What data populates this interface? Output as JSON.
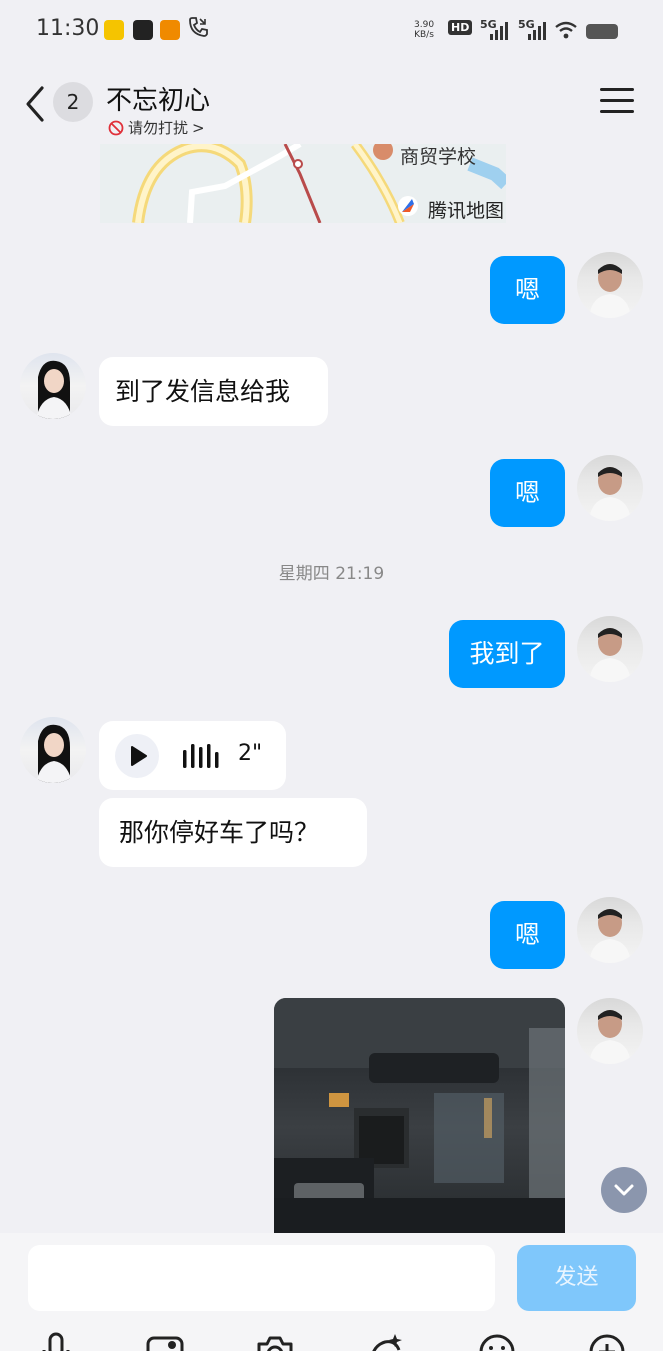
{
  "status_bar": {
    "time": "11:30",
    "net_speed_value": "3.90",
    "net_speed_unit": "KB/s",
    "hd_label": "HD",
    "signal_1": "5G",
    "signal_2": "5G"
  },
  "header": {
    "unread_count": "2",
    "title": "不忘初心",
    "dnd_label": "请勿打扰",
    "dnd_arrow": ">"
  },
  "map": {
    "place_label": "商贸学校",
    "provider": "腾讯地图"
  },
  "messages": {
    "m1": "嗯",
    "m2": "到了发信息给我",
    "m3": "嗯",
    "timestamp": "星期四 21:19",
    "m4": "我到了",
    "voice_duration": "2\"",
    "m5": "那你停好车了吗？",
    "m6": "嗯"
  },
  "input": {
    "placeholder": "",
    "send_label": "发送"
  },
  "colors": {
    "outgoing_bubble": "#0099ff",
    "send_button": "#7fc7fb",
    "background": "#f0f0f4"
  },
  "icons": [
    "back-icon",
    "menu-icon",
    "dnd-icon",
    "play-icon",
    "waveform-icon",
    "chevron-down-icon",
    "mic-icon",
    "image-icon",
    "camera-icon",
    "gift-icon",
    "emoji-icon",
    "plus-icon"
  ]
}
